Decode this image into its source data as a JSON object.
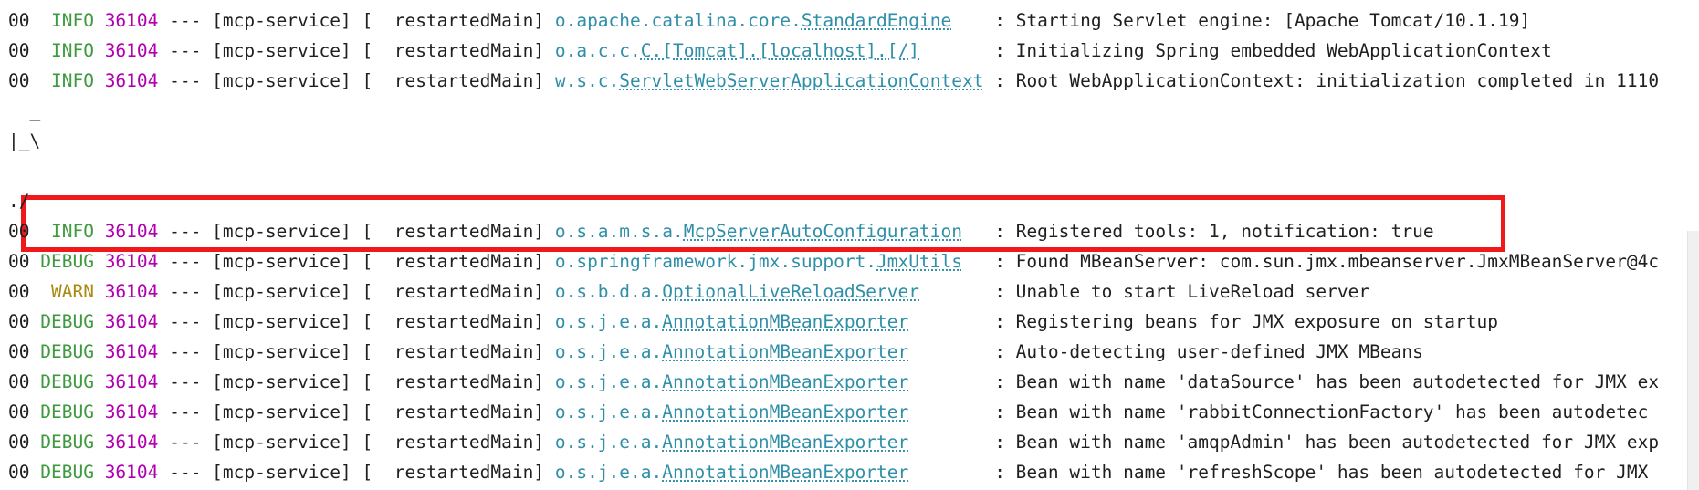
{
  "log_lines": [
    {
      "kind": "log",
      "prefix": "00",
      "level": "INFO",
      "pid": "36104",
      "sep": "---",
      "app": "[mcp-service]",
      "thread": "[  restartedMain]",
      "logger_pkg": "o.apache.catalina.core.",
      "logger_cls": "StandardEngine",
      "message": ": Starting Servlet engine: [Apache Tomcat/10.1.19]"
    },
    {
      "kind": "log",
      "prefix": "00",
      "level": "INFO",
      "pid": "36104",
      "sep": "---",
      "app": "[mcp-service]",
      "thread": "[  restartedMain]",
      "logger_pkg": "o.a.c.c.",
      "logger_cls": "C.[Tomcat].[localhost].[/]",
      "message": ": Initializing Spring embedded WebApplicationContext"
    },
    {
      "kind": "log",
      "prefix": "00",
      "level": "INFO",
      "pid": "36104",
      "sep": "---",
      "app": "[mcp-service]",
      "thread": "[  restartedMain]",
      "logger_pkg": "w.s.c.",
      "logger_cls": "ServletWebServerApplicationContext",
      "message": ": Root WebApplicationContext: initialization completed in 1110"
    },
    {
      "kind": "text",
      "text": "  _"
    },
    {
      "kind": "text",
      "text": "|_\\"
    },
    {
      "kind": "text",
      "text": ""
    },
    {
      "kind": "text",
      "text": "./"
    },
    {
      "kind": "log",
      "prefix": "00",
      "level": "INFO",
      "pid": "36104",
      "sep": "---",
      "app": "[mcp-service]",
      "thread": "[  restartedMain]",
      "logger_pkg": "o.s.a.m.s.a.",
      "logger_cls": "McpServerAutoConfiguration",
      "message": ": Registered tools: 1, notification: true"
    },
    {
      "kind": "log",
      "prefix": "00",
      "level": "DEBUG",
      "pid": "36104",
      "sep": "---",
      "app": "[mcp-service]",
      "thread": "[  restartedMain]",
      "logger_pkg": "o.springframework.jmx.support.",
      "logger_cls": "JmxUtils",
      "message": ": Found MBeanServer: com.sun.jmx.mbeanserver.JmxMBeanServer@4c"
    },
    {
      "kind": "log",
      "prefix": "00",
      "level": "WARN",
      "pid": "36104",
      "sep": "---",
      "app": "[mcp-service]",
      "thread": "[  restartedMain]",
      "logger_pkg": "o.s.b.d.a.",
      "logger_cls": "OptionalLiveReloadServer",
      "message": ": Unable to start LiveReload server"
    },
    {
      "kind": "log",
      "prefix": "00",
      "level": "DEBUG",
      "pid": "36104",
      "sep": "---",
      "app": "[mcp-service]",
      "thread": "[  restartedMain]",
      "logger_pkg": "o.s.j.e.a.",
      "logger_cls": "AnnotationMBeanExporter",
      "message": ": Registering beans for JMX exposure on startup"
    },
    {
      "kind": "log",
      "prefix": "00",
      "level": "DEBUG",
      "pid": "36104",
      "sep": "---",
      "app": "[mcp-service]",
      "thread": "[  restartedMain]",
      "logger_pkg": "o.s.j.e.a.",
      "logger_cls": "AnnotationMBeanExporter",
      "message": ": Auto-detecting user-defined JMX MBeans"
    },
    {
      "kind": "log",
      "prefix": "00",
      "level": "DEBUG",
      "pid": "36104",
      "sep": "---",
      "app": "[mcp-service]",
      "thread": "[  restartedMain]",
      "logger_pkg": "o.s.j.e.a.",
      "logger_cls": "AnnotationMBeanExporter",
      "message": ": Bean with name 'dataSource' has been autodetected for JMX ex"
    },
    {
      "kind": "log",
      "prefix": "00",
      "level": "DEBUG",
      "pid": "36104",
      "sep": "---",
      "app": "[mcp-service]",
      "thread": "[  restartedMain]",
      "logger_pkg": "o.s.j.e.a.",
      "logger_cls": "AnnotationMBeanExporter",
      "message": ": Bean with name 'rabbitConnectionFactory' has been autodetec"
    },
    {
      "kind": "log",
      "prefix": "00",
      "level": "DEBUG",
      "pid": "36104",
      "sep": "---",
      "app": "[mcp-service]",
      "thread": "[  restartedMain]",
      "logger_pkg": "o.s.j.e.a.",
      "logger_cls": "AnnotationMBeanExporter",
      "message": ": Bean with name 'amqpAdmin' has been autodetected for JMX exp"
    },
    {
      "kind": "log",
      "prefix": "00",
      "level": "DEBUG",
      "pid": "36104",
      "sep": "---",
      "app": "[mcp-service]",
      "thread": "[  restartedMain]",
      "logger_pkg": "o.s.j.e.a.",
      "logger_cls": "AnnotationMBeanExporter",
      "message": ": Bean with name 'refreshScope' has been autodetected for JMX"
    }
  ],
  "colors": {
    "level_info": "#3f9a3f",
    "level_debug": "#3f9a3f",
    "level_warn": "#a88a10",
    "pid": "#b000b0",
    "logger": "#2f8fa8",
    "highlight_border": "#f01818"
  }
}
